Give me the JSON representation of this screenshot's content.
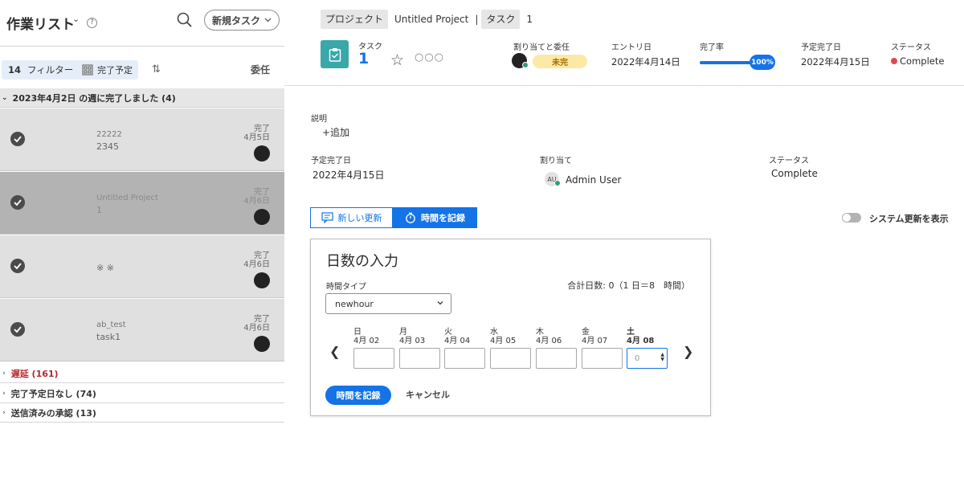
{
  "left": {
    "title": "作業リスト",
    "new_task": "新規タスク",
    "filter_count": "14",
    "filter_label": "フィルター",
    "done_label": "完了予定",
    "delegate_label": "委任",
    "group_title": "2023年4月2日 の週に完了しました (4)",
    "tasks": [
      {
        "line1": "22222",
        "line2": "2345",
        "status": "完了",
        "date": "4月5日"
      },
      {
        "line1": "Untitled Project",
        "line2": "1",
        "status": "完了",
        "date": "4月6日"
      },
      {
        "line1": "",
        "line2": "※ ※",
        "status": "完了",
        "date": "4月6日"
      },
      {
        "line1": "ab_test",
        "line2": "task1",
        "status": "完了",
        "date": "4月6日"
      }
    ],
    "groups": [
      {
        "label": "遅延 (161)"
      },
      {
        "label": "完了予定日なし (74)"
      },
      {
        "label": "送信済みの承認 (13)"
      }
    ]
  },
  "header": {
    "breadcrumb_project_tag": "プロジェクト",
    "breadcrumb_project": "Untitled Project",
    "breadcrumb_sep": "|",
    "breadcrumb_task_tag": "タスク",
    "breadcrumb_task": "1",
    "task_label": "タスク",
    "task_number": "1",
    "more": "○○○",
    "assign_label": "割り当てと委任",
    "assign_badge": "未完",
    "entry_label": "エントリ日",
    "entry_value": "2022年4月14日",
    "progress_label": "完了率",
    "progress_value": "100%",
    "progress_fraction": 1.0,
    "due_label": "予定完了日",
    "due_value": "2022年4月15日",
    "status_label": "ステータス",
    "status_value": "Complete",
    "status_color": "#e34850",
    "accent_color": "#1473e6"
  },
  "details": {
    "desc_label": "説明",
    "add_label": "+追加",
    "due_label": "予定完了日",
    "due_value": "2022年4月15日",
    "assign_label": "割り当て",
    "assign_initials": "AU",
    "assign_value": "Admin User",
    "status_label": "ステータス",
    "status_value": "Complete"
  },
  "tabs": {
    "update": "新しい更新",
    "time": "時間を記録",
    "toggle_label": "システム更新を表示"
  },
  "timesheet": {
    "title": "日数の入力",
    "hour_type_label": "時間タイプ",
    "hour_type_value": "newhour",
    "total_days": "合計日数: 0（1 日＝8　時間）",
    "days": [
      {
        "name": "日",
        "date": "4月 02",
        "value": ""
      },
      {
        "name": "月",
        "date": "4月 03",
        "value": ""
      },
      {
        "name": "火",
        "date": "4月 04",
        "value": ""
      },
      {
        "name": "水",
        "date": "4月 05",
        "value": ""
      },
      {
        "name": "木",
        "date": "4月 06",
        "value": ""
      },
      {
        "name": "金",
        "date": "4月 07",
        "value": ""
      },
      {
        "name": "土",
        "date": "4月 08",
        "value": "0"
      }
    ],
    "record_button": "時間を記録",
    "cancel_button": "キャンセル"
  }
}
